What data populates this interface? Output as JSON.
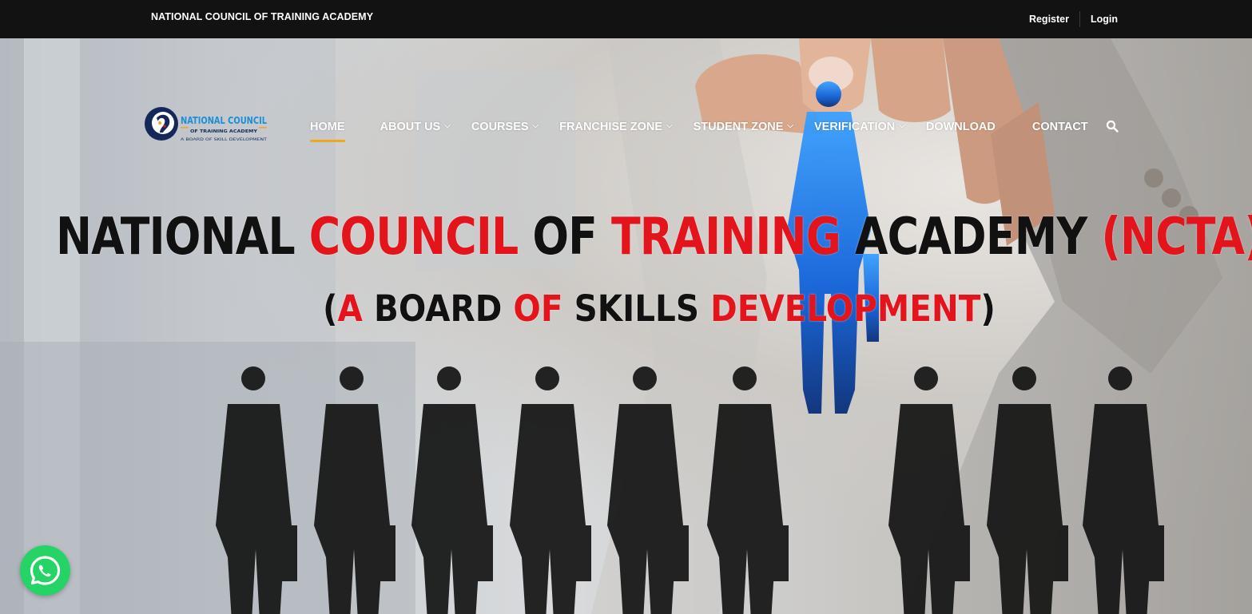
{
  "topbar": {
    "brand": "NATIONAL COUNCIL OF TRAINING ACADEMY",
    "register_label": "Register",
    "login_label": "Login"
  },
  "logo": {
    "line1": "NATIONAL COUNCIL",
    "line2": "OF TRAINING ACADEMY",
    "line3": "A BOARD OF SKILL DEVELOPMENT"
  },
  "nav": {
    "items": [
      {
        "label": "HOME",
        "active": true,
        "dropdown": false
      },
      {
        "label": "ABOUT US",
        "dropdown": true
      },
      {
        "label": "COURSES",
        "dropdown": true
      },
      {
        "label": "FRANCHISE ZONE",
        "dropdown": true
      },
      {
        "label": "STUDENT ZONE",
        "dropdown": true
      },
      {
        "label": "VERIFICATION",
        "dropdown": true
      },
      {
        "label": "DOWNLOAD",
        "dropdown": false
      },
      {
        "label": "CONTACT",
        "dropdown": false
      }
    ],
    "search_icon": "search-icon"
  },
  "hero": {
    "headline": [
      {
        "text": "NATIONAL ",
        "red": false
      },
      {
        "text": "COUNCIL ",
        "red": true
      },
      {
        "text": "OF ",
        "red": false
      },
      {
        "text": "TRAINING ",
        "red": true
      },
      {
        "text": "ACADEMY ",
        "red": false
      },
      {
        "text": "(NCTA)",
        "red": true
      }
    ],
    "subline": [
      {
        "text": "(",
        "red": false
      },
      {
        "text": "A ",
        "red": true
      },
      {
        "text": "BOARD ",
        "red": false
      },
      {
        "text": "OF ",
        "red": true
      },
      {
        "text": "SKILLS ",
        "red": false
      },
      {
        "text": "DEVELOPMENT",
        "red": true
      },
      {
        "text": ")",
        "red": false
      }
    ]
  },
  "colors": {
    "topbar_bg": "#121212",
    "accent_underline": "#f2a71a",
    "headline_red": "#e3141c",
    "whatsapp_green": "#25d366"
  },
  "floating": {
    "whatsapp_icon": "whatsapp-icon"
  }
}
